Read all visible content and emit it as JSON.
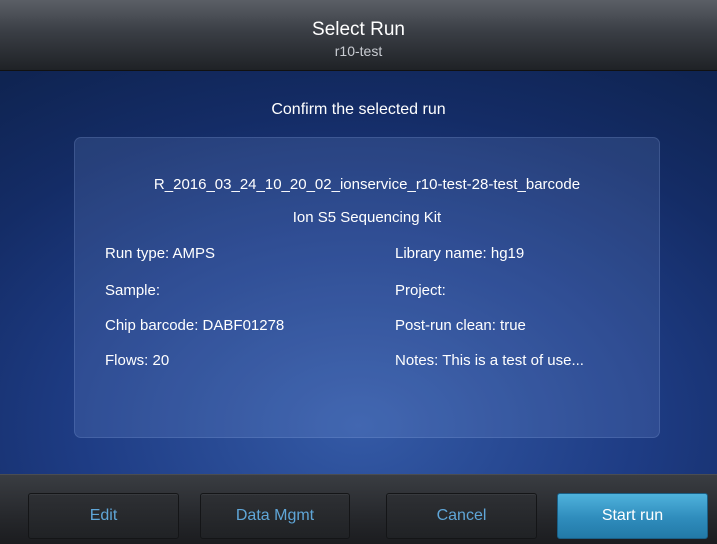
{
  "header": {
    "title": "Select Run",
    "subtitle": "r10-test"
  },
  "main": {
    "prompt": "Confirm the selected run",
    "run_name": "R_2016_03_24_10_20_02_ionservice_r10-test-28-test_barcode",
    "kit_name": "Ion S5 Sequencing Kit",
    "fields_left": [
      "Run type: AMPS",
      "Sample:",
      "Chip barcode: DABF01278",
      "Flows: 20"
    ],
    "fields_right": [
      "Library name: hg19",
      "Project:",
      "Post-run clean: true",
      "Notes: This is a test of use..."
    ]
  },
  "footer": {
    "edit_label": "Edit",
    "data_mgmt_label": "Data Mgmt",
    "cancel_label": "Cancel",
    "start_label": "Start run"
  },
  "colors": {
    "background": "#1e3c84",
    "link_text": "#5fa6d8",
    "primary_button": "#2f8cbc"
  }
}
